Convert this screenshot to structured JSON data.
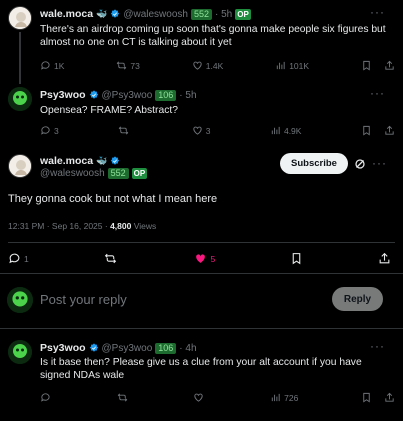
{
  "reply1": {
    "name": "wale.moca",
    "emoji": "🐳",
    "handle": "@waleswoosh",
    "badge": "552",
    "time": "· 5h",
    "op": "OP",
    "line1": "There's an airdrop coming up soon that's gonna make people six figures but",
    "line2": "almost no one on CT is talking about it yet",
    "stats": {
      "replies": "1K",
      "reposts": "73",
      "likes": "1.4K",
      "views": "101K"
    }
  },
  "reply2": {
    "name": "Psy3woo",
    "handle": "@Psy3woo",
    "badge": "106",
    "time": "· 5h",
    "text": "Opensea? FRAME? Abstract?",
    "stats": {
      "replies": "3",
      "reposts": "",
      "likes": "3",
      "views": "4.9K"
    }
  },
  "main": {
    "name": "wale.moca",
    "emoji": "🐳",
    "handle": "@waleswoosh",
    "badge": "552",
    "op": "OP",
    "subscribe": "Subscribe",
    "text": "They gonna cook but not what I mean here",
    "timestamp": "12:31 PM · Sep 16, 2025 · ",
    "views_count": "4,800",
    "views_label": " Views",
    "stats": {
      "replies": "1",
      "reposts": "",
      "likes": "5"
    }
  },
  "composer": {
    "placeholder": "Post your reply",
    "button": "Reply"
  },
  "reply3": {
    "name": "Psy3woo",
    "handle": "@Psy3woo",
    "badge": "106",
    "time": "· 4h",
    "line1": "Is it base then? Please give us a clue from your alt account if you have",
    "line2": "signed NDAs wale",
    "stats": {
      "replies": "",
      "reposts": "",
      "likes": "",
      "views": "726"
    }
  },
  "colors": {
    "accent": "#1d9bf0",
    "like": "#f91880",
    "badge": "#1d6b2e"
  }
}
